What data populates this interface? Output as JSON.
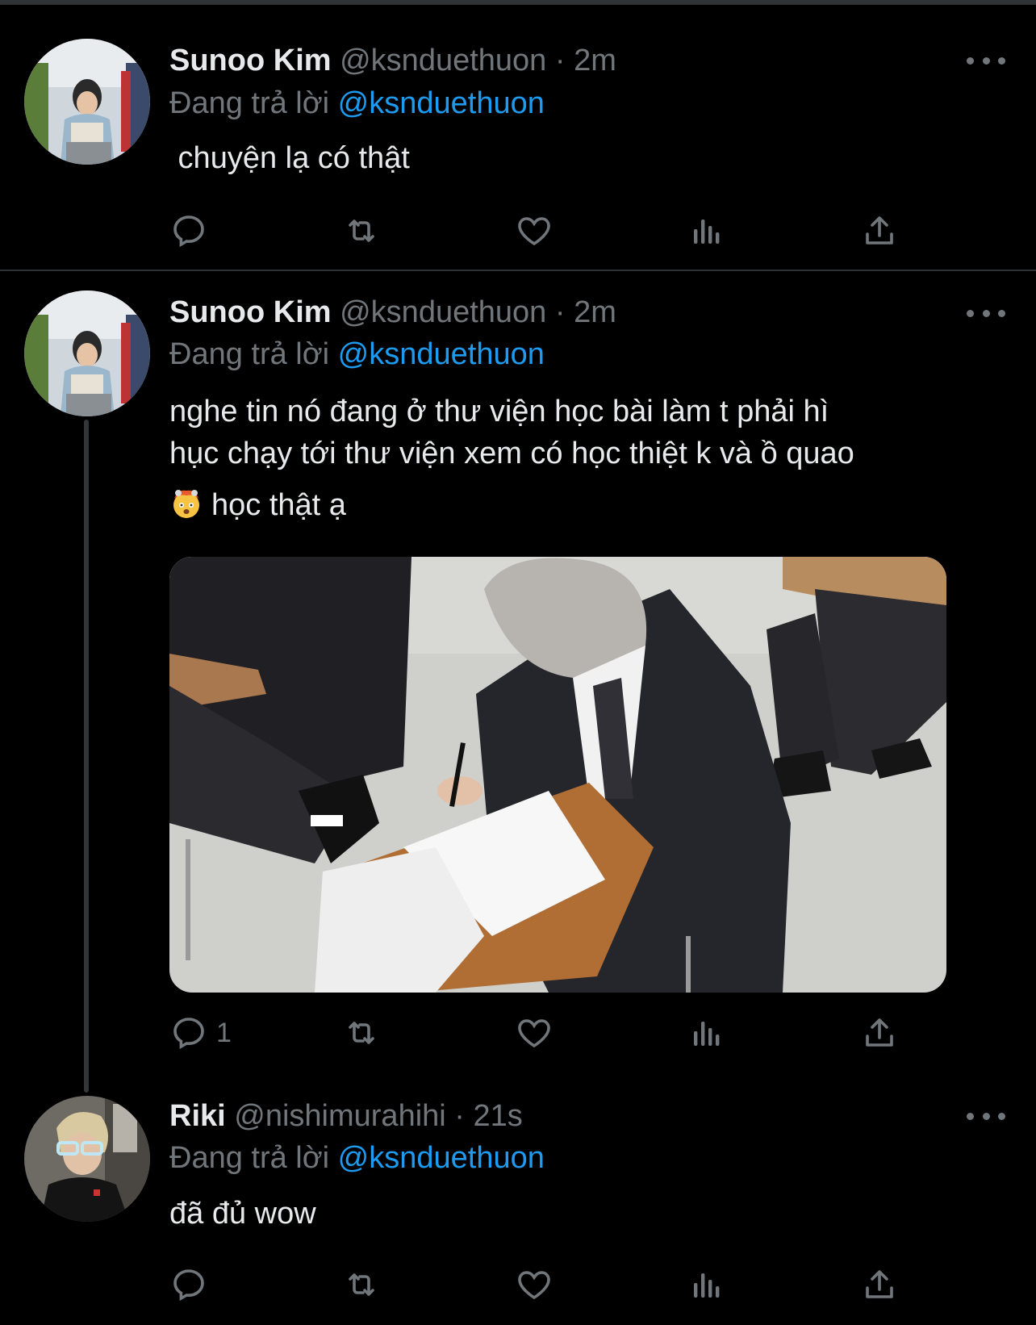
{
  "tweets": [
    {
      "name": "Sunoo Kim",
      "handle": "@ksnduethuon",
      "dot": "·",
      "time": "2m",
      "replying_prefix": "Đang trả lời",
      "replying_to": "@ksnduethuon",
      "text": " chuyện lạ có thật",
      "reply_count": ""
    },
    {
      "name": "Sunoo Kim",
      "handle": "@ksnduethuon",
      "dot": "·",
      "time": "2m",
      "replying_prefix": "Đang trả lời",
      "replying_to": "@ksnduethuon",
      "text_line1": "nghe tin nó đang ở thư viện học bài làm t phải hì",
      "text_line2": "hục chạy tới thư viện xem có học thiệt k và ồ quao",
      "text_line3": "học thật ạ",
      "emoji": "exploding-head-emoji",
      "reply_count": "1"
    },
    {
      "name": "Riki",
      "handle": "@nishimurahihi",
      "dot": "·",
      "time": "21s",
      "replying_prefix": "Đang trả lời",
      "replying_to": "@ksnduethuon",
      "text": "đã đủ wow",
      "reply_count": ""
    }
  ],
  "icons": {
    "reply": "reply-icon",
    "retweet": "retweet-icon",
    "like": "heart-icon",
    "views": "views-icon",
    "share": "share-icon",
    "more": "more-icon"
  },
  "colors": {
    "background": "#000000",
    "text": "#e7e9ea",
    "secondary": "#71767b",
    "accent": "#1d9bf0",
    "divider": "#2f3336"
  }
}
